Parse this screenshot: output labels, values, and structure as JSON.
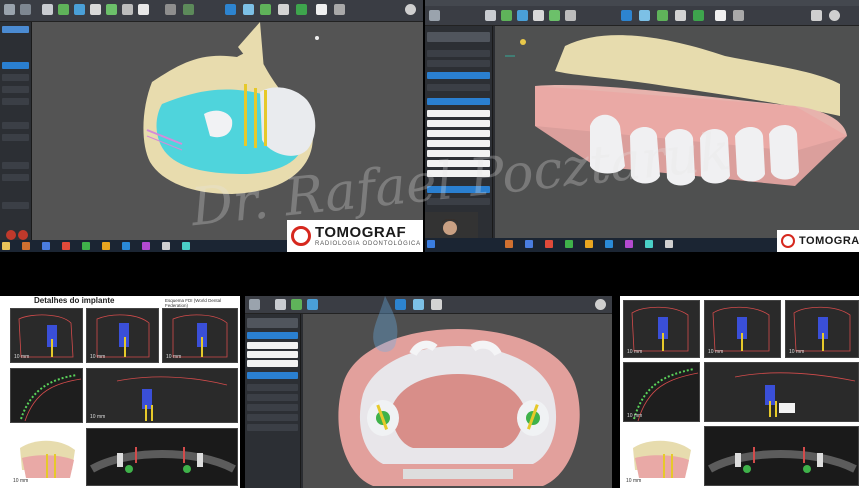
{
  "brand": {
    "logo_main": "TOMOGRAF",
    "logo_sub": "RADIOLOGIA ODONTOLÓGICA",
    "logo_main_right": "TOMOGRAF",
    "accent_red": "#d6281e"
  },
  "watermark": {
    "signature": "Dr. Rafael Pocztaruk"
  },
  "report_left": {
    "title": "Detalhes do implante",
    "subtitle": "Esquema FDI (World Dental Federation)",
    "scale_labels": [
      "10 mm",
      "10 mm",
      "10 mm",
      "10 mm",
      "10 mm"
    ]
  },
  "report_right": {
    "scale_labels": [
      "10 mm",
      "10 mm",
      "10 mm",
      "10 mm",
      "10 mm"
    ]
  },
  "colors": {
    "guide_cyan": "#48d6e0",
    "bone": "#e7dcae",
    "gingiva": "#e9a9a6",
    "viewport": "#545454",
    "toolbar": "#3a3d44",
    "taskbar": "#1b2533"
  },
  "icons": {
    "presenter": "person-webcam",
    "windows": "windows-icon"
  }
}
